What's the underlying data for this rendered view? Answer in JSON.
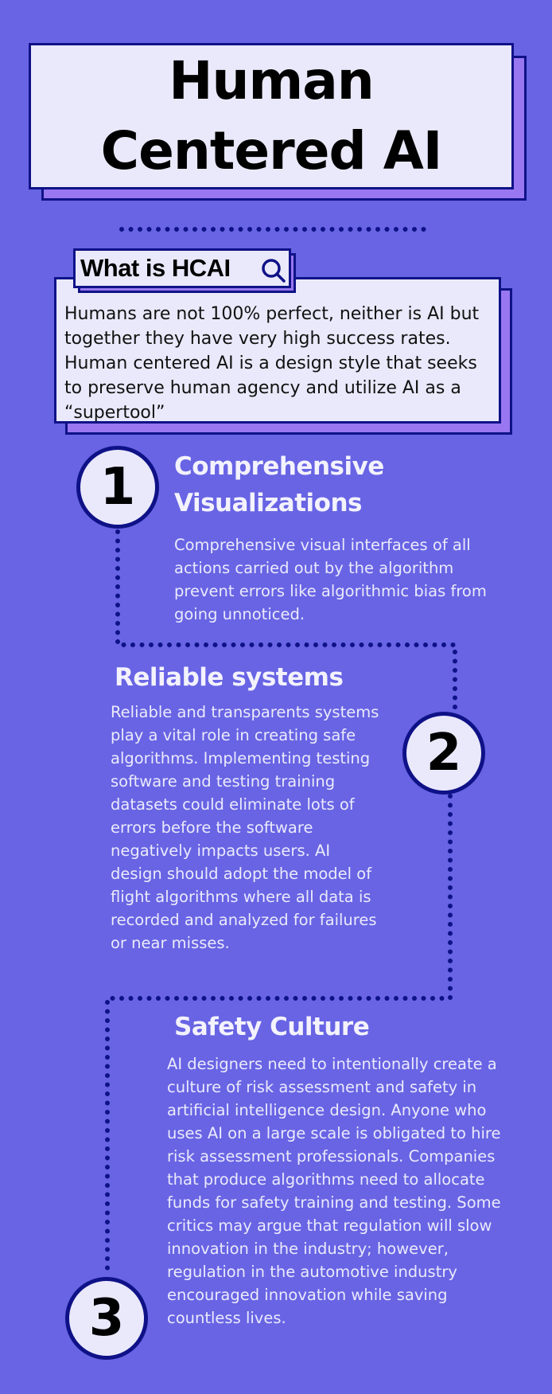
{
  "title": {
    "line1": "Human",
    "line2": "Centered AI"
  },
  "intro": {
    "label": "What is HCAI",
    "label_icon": "search-icon",
    "text": "Humans are not 100% perfect, neither is AI  but together they have very high success rates. Human centered AI is a design style that seeks to preserve human agency and utilize AI as a “supertool”"
  },
  "sections": [
    {
      "number": "1",
      "heading": "Comprehensive Visualizations",
      "body": "Comprehensive visual interfaces of all actions carried out by the algorithm prevent errors like algorithmic bias from going unnoticed."
    },
    {
      "number": "2",
      "heading": "Reliable systems",
      "body": "Reliable and transparents systems play a vital role in creating safe algorithms. Implementing testing software and testing training datasets could eliminate lots of errors before the software negatively impacts users. AI design should adopt the model of flight algorithms where all data is recorded and analyzed for failures or near misses."
    },
    {
      "number": "3",
      "heading": "Safety Culture",
      "body": " AI designers need to intentionally create a culture of risk assessment and safety in artificial intelligence design. Anyone who uses AI on a large scale is obligated to hire risk assessment professionals. Companies that produce algorithms need to allocate funds for safety training and testing. Some critics may argue that regulation will slow innovation in the industry; however, regulation in the automotive industry encouraged innovation while saving countless lives."
    }
  ],
  "colors": {
    "background": "#6864e4",
    "navy": "#0f1287",
    "panel": "#eae9fb",
    "shadow": "#9877f0"
  }
}
